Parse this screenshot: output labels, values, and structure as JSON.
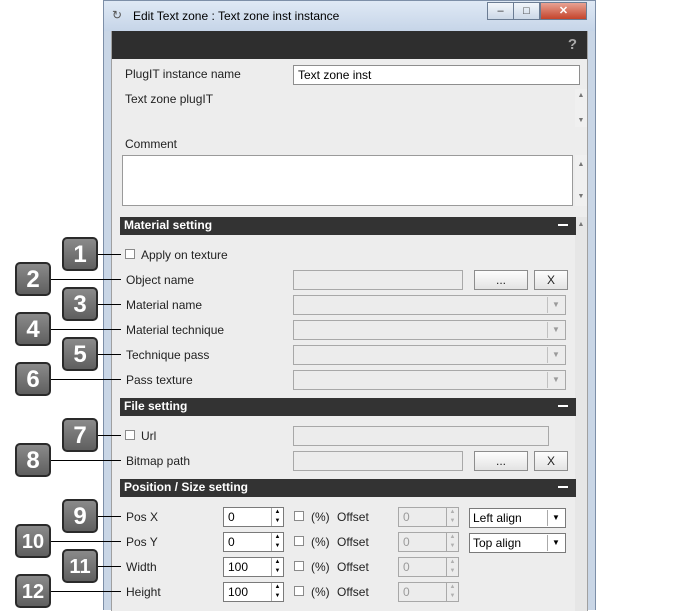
{
  "window": {
    "title": "Edit Text zone : Text zone inst instance",
    "minimize": "–",
    "maximize": "□",
    "close": "✕",
    "help": "?"
  },
  "instance": {
    "name_label": "PlugIT instance name",
    "name_value": "Text zone inst",
    "plugit_label": "Text zone plugIT",
    "comment_label": "Comment",
    "comment_value": ""
  },
  "material": {
    "header": "Material setting",
    "apply_texture": "Apply on texture",
    "object_name": "Object name",
    "browse": "...",
    "clear": "X",
    "material_name": "Material name",
    "material_technique": "Material technique",
    "technique_pass": "Technique pass",
    "pass_texture": "Pass texture"
  },
  "file": {
    "header": "File setting",
    "url": "Url",
    "bitmap_path": "Bitmap path",
    "browse": "...",
    "clear": "X"
  },
  "position": {
    "header": "Position / Size setting",
    "percent": "(%)",
    "offset": "Offset",
    "rows": [
      {
        "label": "Pos X",
        "value": "0",
        "offset": "0"
      },
      {
        "label": "Pos Y",
        "value": "0",
        "offset": "0"
      },
      {
        "label": "Width",
        "value": "100",
        "offset": "0"
      },
      {
        "label": "Height",
        "value": "100",
        "offset": "0"
      }
    ],
    "h_align": "Left align",
    "v_align": "Top align"
  },
  "callouts": [
    "1",
    "2",
    "3",
    "4",
    "5",
    "6",
    "7",
    "8",
    "9",
    "10",
    "11",
    "12"
  ]
}
